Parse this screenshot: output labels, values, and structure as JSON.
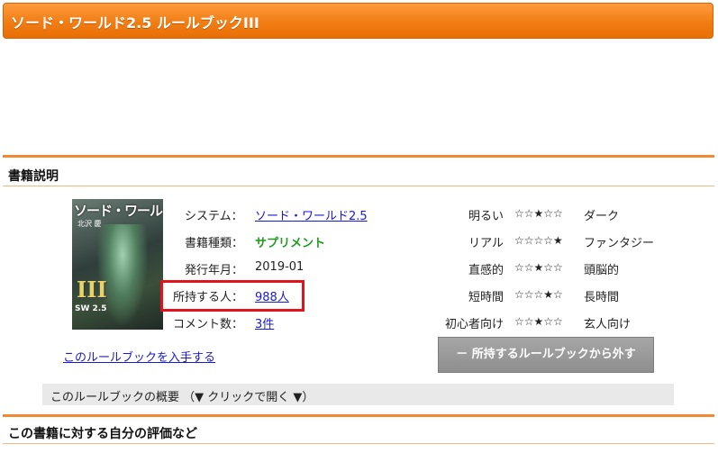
{
  "header": {
    "title": "ソード・ワールド2.5 ルールブックIII"
  },
  "section_book": {
    "heading": "書籍説明"
  },
  "cover": {
    "logo_title": "ソード・ワールド",
    "author": "北沢 慶",
    "volume": "III",
    "brand": "SW 2.5"
  },
  "details": {
    "system_label": "システム：",
    "system_value": "ソード・ワールド2.5",
    "type_label": "書籍種類：",
    "type_value": "サプリメント",
    "date_label": "発行年月：",
    "date_value": "2019-01",
    "owners_label": "所持する人：",
    "owners_value": "988人",
    "comments_label": "コメント数：",
    "comments_value": "3件"
  },
  "ratings": [
    {
      "left": "明るい",
      "stars": "☆☆★☆☆",
      "right": "ダーク",
      "level": 3
    },
    {
      "left": "リアル",
      "stars": "☆☆☆☆★",
      "right": "ファンタジー",
      "level": 5
    },
    {
      "left": "直感的",
      "stars": "☆☆★☆☆",
      "right": "頭脳的",
      "level": 3
    },
    {
      "left": "短時間",
      "stars": "☆☆☆★☆",
      "right": "長時間",
      "level": 4
    },
    {
      "left": "初心者向け",
      "stars": "☆☆★☆☆",
      "right": "玄人向け",
      "level": 3
    }
  ],
  "actions": {
    "get_link": "このルールブックを入手する",
    "remove_button": "－ 所持するルールブックから外す"
  },
  "summary": {
    "label": "このルールブックの概要 （▼ クリックで開く ▼）"
  },
  "section_eval": {
    "heading": "この書籍に対する自分の評価など"
  },
  "colors": {
    "accent": "#f07d14",
    "highlight": "#e0141a",
    "link": "#1a1ad0",
    "green": "#1f9a1f"
  }
}
